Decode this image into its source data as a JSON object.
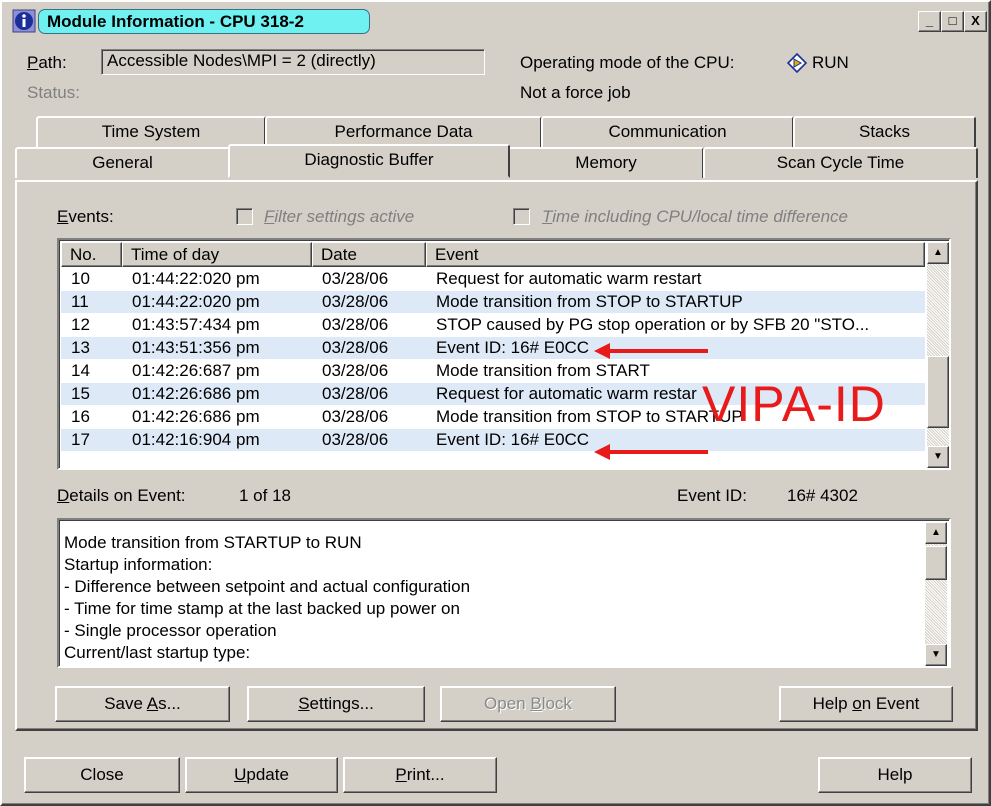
{
  "window": {
    "title": "Module Information - CPU 318-2",
    "controls": {
      "minimize": "_",
      "maximize": "□",
      "close": "X"
    }
  },
  "header": {
    "path_label_prefix": "P",
    "path_label_rest": "ath:",
    "path_value": "Accessible Nodes\\MPI =  2 (directly)",
    "status_label": "Status:",
    "mode_label": "Operating mode of the  CPU:",
    "mode_value": "RUN",
    "force_text": "Not a force job"
  },
  "tabs": {
    "row_top": [
      "Time System",
      "Performance Data",
      "Communication",
      "Stacks"
    ],
    "row_bottom": [
      "General",
      "Diagnostic Buffer",
      "Memory",
      "Scan Cycle Time"
    ],
    "active": "Diagnostic Buffer"
  },
  "events": {
    "label_prefix": "E",
    "label_rest": "vents:",
    "filter_prefix": "F",
    "filter_rest": "ilter settings active",
    "time_prefix": "T",
    "time_rest": "ime including CPU/local time difference",
    "columns": [
      "No.",
      "Time of day",
      "Date",
      "Event"
    ],
    "rows": [
      {
        "no": "10",
        "time": "01:44:22:020 pm",
        "date": "03/28/06",
        "event": "Request for automatic warm restart"
      },
      {
        "no": "11",
        "time": "01:44:22:020 pm",
        "date": "03/28/06",
        "event": "Mode transition from STOP to STARTUP"
      },
      {
        "no": "12",
        "time": "01:43:57:434 pm",
        "date": "03/28/06",
        "event": "STOP caused by PG stop operation or by SFB 20 \"STO..."
      },
      {
        "no": "13",
        "time": "01:43:51:356 pm",
        "date": "03/28/06",
        "event": "Event ID: 16# E0CC"
      },
      {
        "no": "14",
        "time": "01:42:26:687 pm",
        "date": "03/28/06",
        "event": "Mode transition from START"
      },
      {
        "no": "15",
        "time": "01:42:26:686 pm",
        "date": "03/28/06",
        "event": "Request for automatic warm restar"
      },
      {
        "no": "16",
        "time": "01:42:26:686 pm",
        "date": "03/28/06",
        "event": "Mode transition from STOP to STARTUP"
      },
      {
        "no": "17",
        "time": "01:42:16:904 pm",
        "date": "03/28/06",
        "event": "Event ID: 16# E0CC"
      }
    ]
  },
  "details": {
    "label_prefix": "D",
    "label_rest": "etails on Event:",
    "count": "1 of 18",
    "event_id_label": "Event ID:",
    "event_id_value": "16# 4302",
    "lines": [
      "Mode transition from STARTUP to RUN",
      "Startup information:",
      "- Difference between setpoint and actual configuration",
      "- Time for time stamp at the last backed up power on",
      "- Single processor operation",
      "Current/last startup type:"
    ]
  },
  "buttons": {
    "save_as": {
      "pre": "Save ",
      "u": "A",
      "post": "s..."
    },
    "settings": {
      "pre": "",
      "u": "S",
      "post": "ettings..."
    },
    "open_block": {
      "pre": "Open ",
      "u": "B",
      "post": "lock"
    },
    "help_on_event": {
      "pre": "Help ",
      "u": "o",
      "post": "n Event"
    },
    "close": "Close",
    "update": {
      "pre": "",
      "u": "U",
      "post": "pdate"
    },
    "print": {
      "pre": "",
      "u": "P",
      "post": "rint..."
    },
    "help": "Help"
  },
  "annotation": {
    "text": "VIPA-ID",
    "color": "#e81a1a"
  },
  "colors": {
    "title_highlight": "#6ff1f1",
    "row_alt": "#dde9f7",
    "face": "#d4d0c8"
  }
}
